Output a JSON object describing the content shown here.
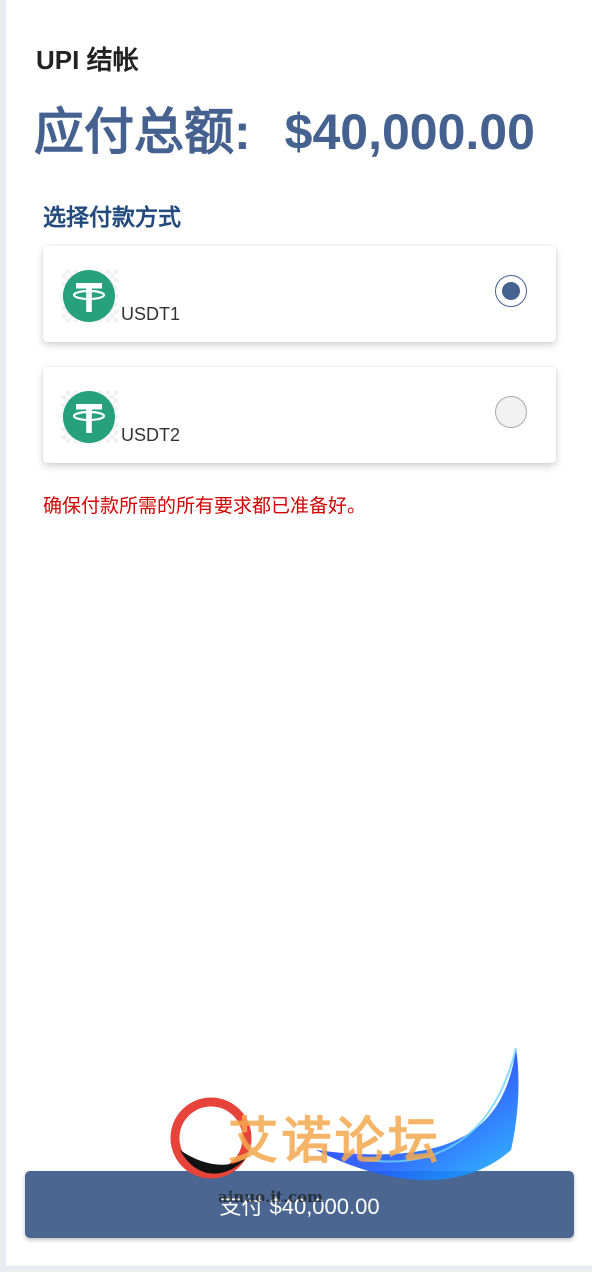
{
  "header": {
    "title": "UPI 结帐",
    "amount_label": "应付总额:",
    "amount_value": "$40,000.00"
  },
  "payment": {
    "section_title": "选择付款方式",
    "methods": [
      {
        "label": "USDT1",
        "icon": "tether-usdt-icon",
        "selected": true
      },
      {
        "label": "USDT2",
        "icon": "tether-usdt-icon",
        "selected": false
      }
    ],
    "notice": "确保付款所需的所有要求都已准备好。"
  },
  "pay_button": {
    "label": "支付 $40,000.00"
  },
  "watermark": {
    "text": "艾诺论坛",
    "domain": "ainuo.it.com"
  },
  "colors": {
    "accent": "#45618f",
    "section_title": "#234a7e",
    "notice": "#d40000",
    "button": "#4a6691",
    "tether_green": "#26a17b"
  }
}
